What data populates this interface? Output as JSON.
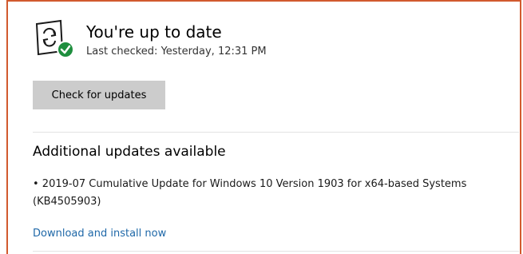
{
  "status": {
    "icon": "sync-check-icon",
    "title": "You're up to date",
    "last_checked": "Last checked: Yesterday, 12:31 PM"
  },
  "check_button": {
    "label": "Check for updates"
  },
  "additional": {
    "title": "Additional updates available",
    "update_name": "• 2019-07 Cumulative Update for Windows 10 Version 1903 for x64-based Systems",
    "update_kb": "(KB4505903)",
    "link_label": "Download and install now"
  },
  "colors": {
    "accent_link": "#1f68a8",
    "check_badge": "#1e8e3e",
    "button_bg": "#cccccc",
    "frame_border": "#d15a2e"
  }
}
